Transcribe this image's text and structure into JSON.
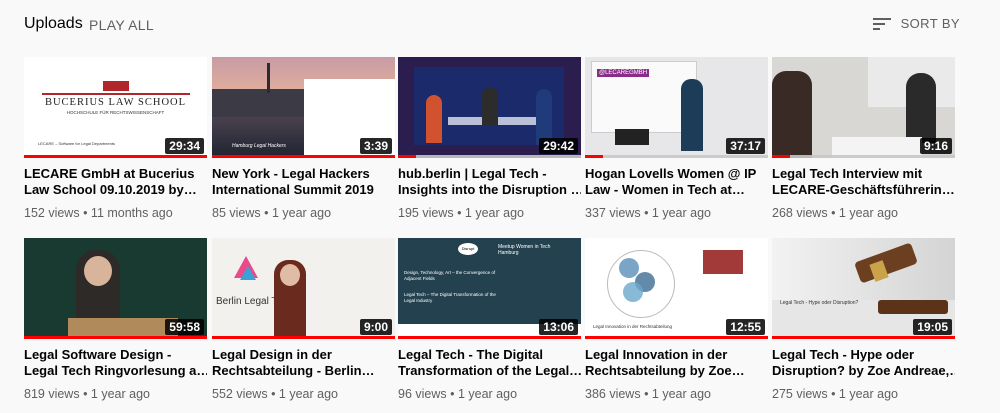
{
  "header": {
    "title": "Uploads",
    "play_all": "PLAY ALL",
    "sort_by": "SORT BY"
  },
  "thumb_text": {
    "bucerius_line1": "BUCERIUS LAW SCHOOL",
    "bucerius_line2": "HOCHSCHULE FÜR RECHTSWISSENSCHAFT",
    "lecare_caption": "LECARE – Software for Legal Departments",
    "hamburg_caption": "Hamburg Legal Hackers",
    "lecare_badge": "@LECAREGMBH",
    "berlin_legal": "Berlin Legal Te",
    "disrupt": "Disrupt",
    "meetup_title": "Meetup Women in Tech Hamburg",
    "design_line": "Design, Technology, Art – the Convergence of Adjacent Fields",
    "legaltech_line": "Legal Tech – The Digital Transformation of the Legal Industry",
    "legal_innovation_caption": "Legal Innovation in der Rechtsabteilung",
    "hype_caption": "Legal Tech - Hype oder Disruption?"
  },
  "videos": [
    {
      "title_l1": "LECARE GmbH at Bucerius",
      "title_l2": "Law School 09.10.2019 by…",
      "duration": "29:34",
      "views": "152 views",
      "age": "11 months ago",
      "progress": 100
    },
    {
      "title_l1": "New York - Legal Hackers",
      "title_l2": "International Summit 2019",
      "duration": "3:39",
      "views": "85 views",
      "age": "1 year ago",
      "progress": 100
    },
    {
      "title_l1": "hub.berlin | Legal Tech -",
      "title_l2": "Insights into the Disruption …",
      "duration": "29:42",
      "views": "195 views",
      "age": "1 year ago",
      "progress": 10
    },
    {
      "title_l1": "Hogan Lovells Women @ IP",
      "title_l2": "Law - Women in Tech at…",
      "duration": "37:17",
      "views": "337 views",
      "age": "1 year ago",
      "progress": 10
    },
    {
      "title_l1": "Legal Tech Interview mit",
      "title_l2": "LECARE-Geschäftsführerin…",
      "duration": "9:16",
      "views": "268 views",
      "age": "1 year ago",
      "progress": 10
    },
    {
      "title_l1": "Legal Software Design -",
      "title_l2": "Legal Tech Ringvorlesung a…",
      "duration": "59:58",
      "views": "819 views",
      "age": "1 year ago",
      "progress": 100
    },
    {
      "title_l1": "Legal Design in der",
      "title_l2": "Rechtsabteilung - Berlin…",
      "duration": "9:00",
      "views": "552 views",
      "age": "1 year ago",
      "progress": 100
    },
    {
      "title_l1": "Legal Tech - The Digital",
      "title_l2": "Transformation of the Legal…",
      "duration": "13:06",
      "views": "96 views",
      "age": "1 year ago",
      "progress": 100
    },
    {
      "title_l1": "Legal Innovation in der",
      "title_l2": "Rechtsabteilung by Zoe…",
      "duration": "12:55",
      "views": "386 views",
      "age": "1 year ago",
      "progress": 100
    },
    {
      "title_l1": "Legal Tech - Hype oder",
      "title_l2": "Disruption? by Zoe Andreae,…",
      "duration": "19:05",
      "views": "275 views",
      "age": "1 year ago",
      "progress": 100
    }
  ]
}
